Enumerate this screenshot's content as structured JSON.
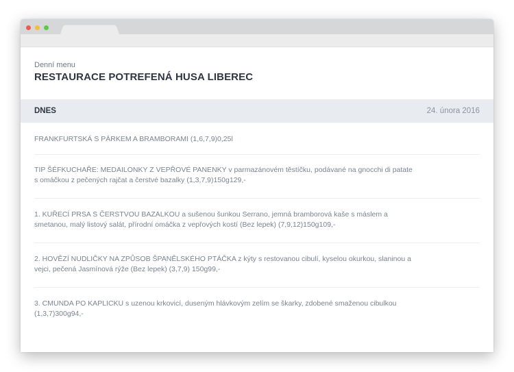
{
  "header": {
    "subtitle": "Denní menu",
    "title": "RESTAURACE POTREFENÁ HUSA LIBEREC"
  },
  "day": {
    "label": "DNES",
    "date": "24. února 2016"
  },
  "items": [
    {
      "text": "FRANKFURTSKÁ S PÁRKEM A BRAMBORAMI (1,6,7,9)0,25l"
    },
    {
      "text": "TIP ŠÉFKUCHAŘE: MEDAILONKY Z VEPŘOVÉ PANENKY v parmazánovém těstíčku, podávané na gnocchi di patate s omáčkou z pečených rajčat a čerstvé bazalky (1,3,7,9)150g129,-"
    },
    {
      "text": "1. KUŘECÍ PRSA S ČERSTVOU BAZALKOU a sušenou šunkou Serrano, jemná bramborová kaše s máslem a smetanou, malý listový salát, přírodní omáčka z vepřových kostí (Bez lepek) (7,9,12)150g109,-"
    },
    {
      "text": "2. HOVĚZÍ NUDLIČKY NA ZPŮSOB ŠPANĚLSKÉHO PTÁČKA z kýty s restovanou cibulí, kyselou okurkou, slaninou a vejci, pečená Jasmínová rýže (Bez lepek) (3,7,9) 150g99,-"
    },
    {
      "text": "3. CMUNDA PO KAPLICKU s uzenou krkovicí, duseným hlávkovým zelím se škarky, zdobené smaženou cibulkou (1,3,7)300g94,-"
    }
  ]
}
